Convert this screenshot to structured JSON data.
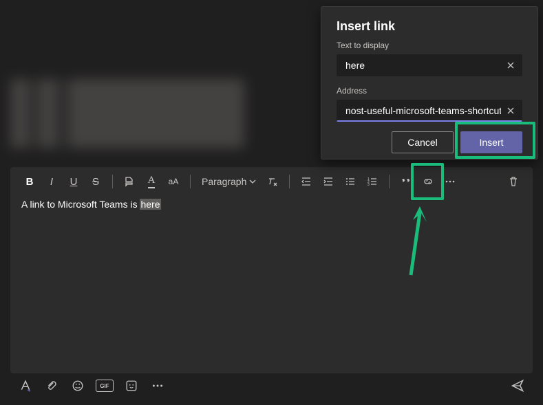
{
  "dialog": {
    "title": "Insert link",
    "text_label": "Text to display",
    "text_value": "here",
    "address_label": "Address",
    "address_value": "nost-useful-microsoft-teams-shortcuts/",
    "cancel_label": "Cancel",
    "insert_label": "Insert"
  },
  "toolbar": {
    "bold": "B",
    "italic": "I",
    "underline": "U",
    "strike": "S",
    "paragraph_label": "Paragraph",
    "font_color_letter": "A",
    "font_size_letters": "aA"
  },
  "editor": {
    "prefix_text": "A link to Microsoft Teams is ",
    "selected_text": "here"
  },
  "bottombar": {
    "gif_label": "GIF"
  },
  "icons": {
    "highlighter": "highlighter-icon",
    "clear_formatting": "clear-formatting-icon",
    "dedent": "dedent-icon",
    "indent": "indent-icon",
    "bullets": "bullet-list-icon",
    "numbers": "numbered-list-icon",
    "quote": "quote-icon",
    "link": "link-icon",
    "more": "more-icon",
    "delete": "trash-icon",
    "format": "format-painter-icon",
    "attachment": "paperclip-icon",
    "emoji": "smiley-icon",
    "sticker": "sticker-icon",
    "more_bottom": "more-icon",
    "send": "send-icon",
    "chevron": "chevron-down-icon",
    "close": "close-icon"
  }
}
